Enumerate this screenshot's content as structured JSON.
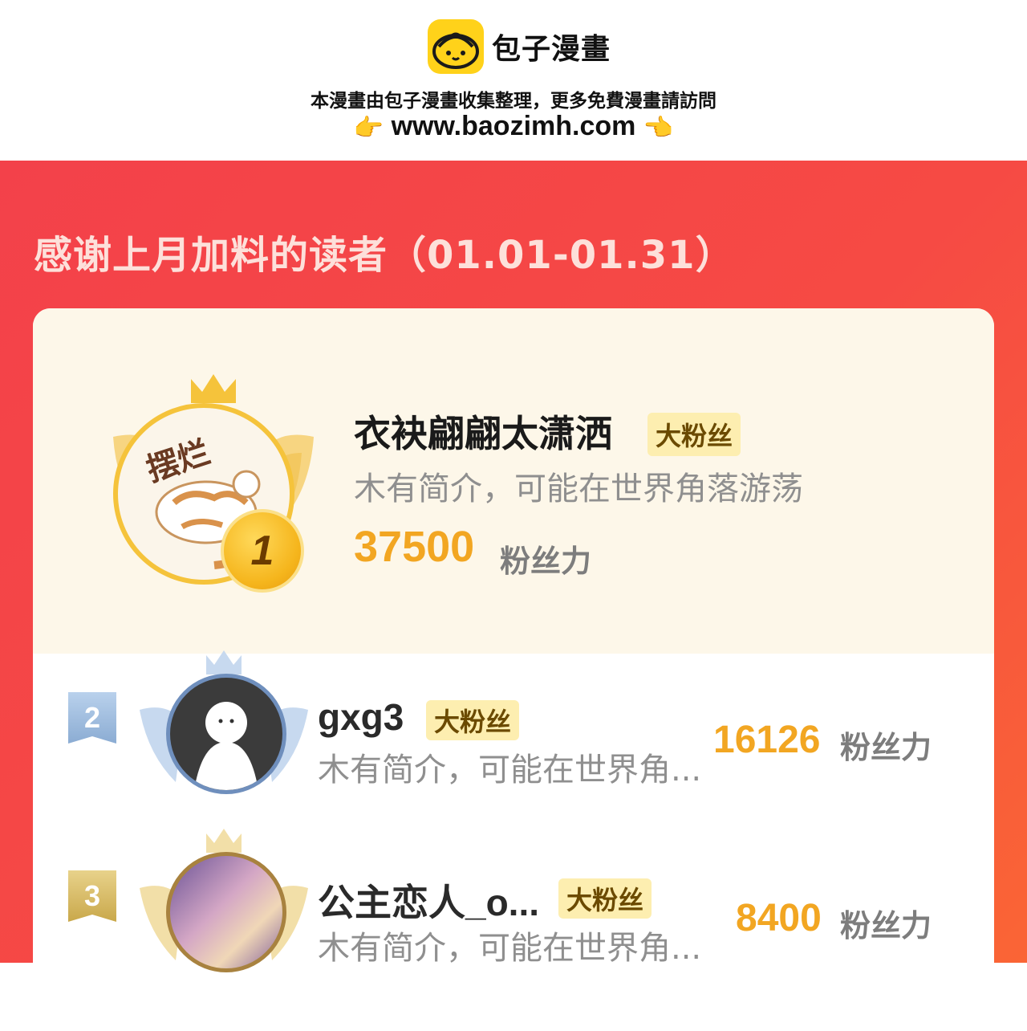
{
  "banner": {
    "brand_name": "包子漫畫",
    "line1": "本漫畫由包子漫畫收集整理，更多免費漫畫請訪問",
    "url": "www.baozimh.com",
    "hand_left": "👉",
    "hand_right": "👈"
  },
  "ranking": {
    "title": "感谢上月加料的读者（01.01-01.31）",
    "entries": [
      {
        "rank": "1",
        "avatar_text": "摆烂",
        "name": "衣袂翩翩太潇洒",
        "badge": "大粉丝",
        "intro": "木有简介，可能在世界角落游荡",
        "score": "37500",
        "unit": "粉丝力"
      },
      {
        "rank": "2",
        "name": "gxg3",
        "badge": "大粉丝",
        "intro": "木有简介，可能在世界角...",
        "score": "16126",
        "unit": "粉丝力"
      },
      {
        "rank": "3",
        "name": "公主恋人_o...",
        "badge": "大粉丝",
        "intro": "木有简介，可能在世界角...",
        "score": "8400",
        "unit": "粉丝力"
      }
    ]
  },
  "colors": {
    "brand_yellow": "#ffd21a",
    "rank_bg": "#f3414a",
    "score_orange": "#f2a622",
    "first_bg": "#fdf7e9"
  },
  "icons": [
    "baozi-logo-icon",
    "pointing-hand-icon",
    "crown-icon",
    "wings-icon",
    "rank-medal-icon",
    "rank-ribbon-icon"
  ]
}
